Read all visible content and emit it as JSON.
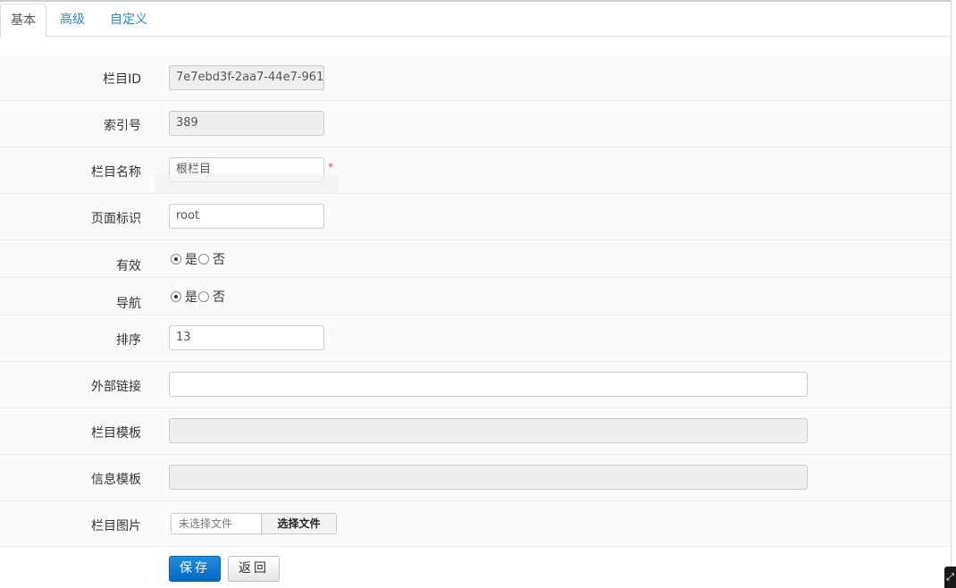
{
  "tabs": [
    {
      "label": "基本"
    },
    {
      "label": "高级"
    },
    {
      "label": "自定义"
    }
  ],
  "fields": {
    "column_id": {
      "label": "栏目ID",
      "value": "7e7ebd3f-2aa7-44e7-961"
    },
    "index_no": {
      "label": "索引号",
      "value": "389"
    },
    "column_name": {
      "label": "栏目名称",
      "value": "根栏目",
      "required_mark": "*"
    },
    "page_id": {
      "label": "页面标识",
      "value": "root"
    },
    "valid": {
      "label": "有效",
      "options": [
        "是",
        "否"
      ],
      "selected": "是"
    },
    "nav": {
      "label": "导航",
      "options": [
        "是",
        "否"
      ],
      "selected": "是"
    },
    "order": {
      "label": "排序",
      "value": "13"
    },
    "external_link": {
      "label": "外部链接",
      "value": ""
    },
    "column_template": {
      "label": "栏目模板",
      "value": ""
    },
    "info_template": {
      "label": "信息模板",
      "value": ""
    },
    "column_image": {
      "label": "栏目图片",
      "placeholder": "未选择文件",
      "choose_label": "选择文件"
    }
  },
  "actions": {
    "save_label": "保存",
    "back_label": "返回"
  },
  "colors": {
    "tab_link": "#2a8ab8",
    "primary_button": "#0767c1",
    "required": "#d9534f"
  }
}
